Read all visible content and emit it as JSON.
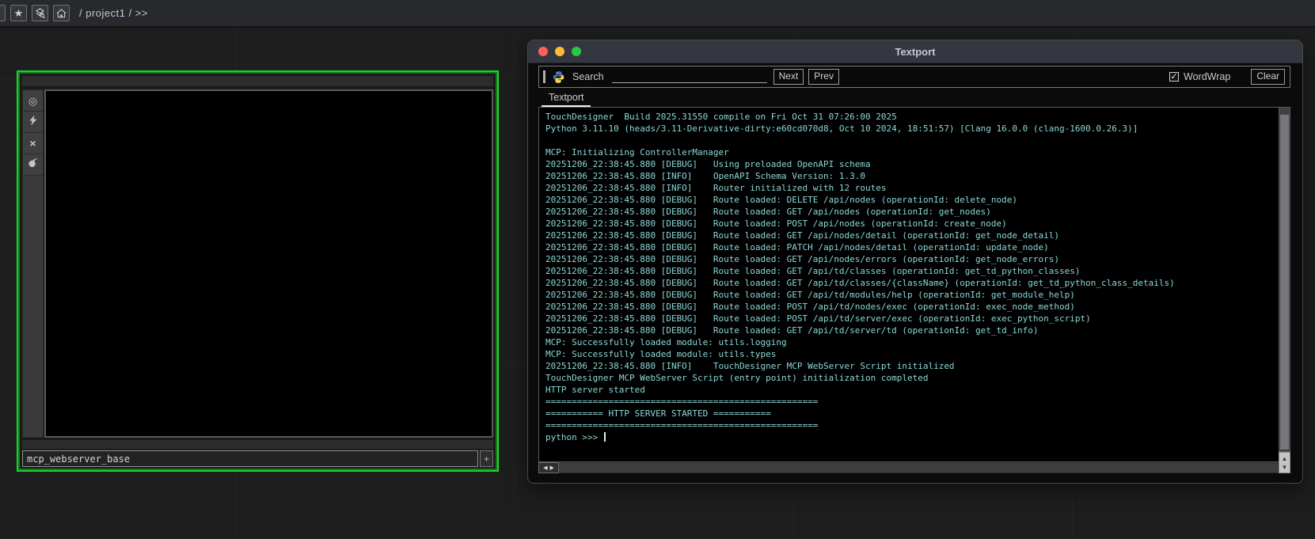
{
  "page_bg": "#1e1e1f",
  "top_toolbar": {
    "breadcrumb": "/ project1 / >>",
    "icons": [
      "star-icon",
      "palette-search-icon",
      "home-icon"
    ]
  },
  "glyphs": {
    "star": "★",
    "plus": "+",
    "check": "✓",
    "close_x": "×",
    "bullseye": "◎",
    "arrow_left": "◀",
    "arrow_right": "▶",
    "arrow_up": "▲",
    "arrow_down": "▼"
  },
  "node_panel": {
    "name_value": "mcp_webserver_base",
    "selection_color": "#21cd2e",
    "flag_icons": [
      "bullseye-icon",
      "lightning-icon",
      "close-x-icon",
      "bomb-icon"
    ]
  },
  "textport": {
    "window_title": "Textport",
    "traffic_light_colors": [
      "#ff5f57",
      "#febc2e",
      "#28c840"
    ],
    "search_label": "Search",
    "search_value": "",
    "next_label": "Next",
    "prev_label": "Prev",
    "wordwrap_label": "WordWrap",
    "wordwrap_checked": true,
    "clear_label": "Clear",
    "tab_label": "Textport",
    "console_text_color": "#8ed7d7",
    "prompt": "python >>> ",
    "console_lines": [
      "TouchDesigner  Build 2025.31550 compile on Fri Oct 31 07:26:00 2025",
      "Python 3.11.10 (heads/3.11-Derivative-dirty:e60cd070d8, Oct 10 2024, 18:51:57) [Clang 16.0.0 (clang-1600.0.26.3)]",
      "",
      "MCP: Initializing ControllerManager",
      "20251206_22:38:45.880 [DEBUG]   Using preloaded OpenAPI schema",
      "20251206_22:38:45.880 [INFO]    OpenAPI Schema Version: 1.3.0",
      "20251206_22:38:45.880 [INFO]    Router initialized with 12 routes",
      "20251206_22:38:45.880 [DEBUG]   Route loaded: DELETE /api/nodes (operationId: delete_node)",
      "20251206_22:38:45.880 [DEBUG]   Route loaded: GET /api/nodes (operationId: get_nodes)",
      "20251206_22:38:45.880 [DEBUG]   Route loaded: POST /api/nodes (operationId: create_node)",
      "20251206_22:38:45.880 [DEBUG]   Route loaded: GET /api/nodes/detail (operationId: get_node_detail)",
      "20251206_22:38:45.880 [DEBUG]   Route loaded: PATCH /api/nodes/detail (operationId: update_node)",
      "20251206_22:38:45.880 [DEBUG]   Route loaded: GET /api/nodes/errors (operationId: get_node_errors)",
      "20251206_22:38:45.880 [DEBUG]   Route loaded: GET /api/td/classes (operationId: get_td_python_classes)",
      "20251206_22:38:45.880 [DEBUG]   Route loaded: GET /api/td/classes/{className} (operationId: get_td_python_class_details)",
      "20251206_22:38:45.880 [DEBUG]   Route loaded: GET /api/td/modules/help (operationId: get_module_help)",
      "20251206_22:38:45.880 [DEBUG]   Route loaded: POST /api/td/nodes/exec (operationId: exec_node_method)",
      "20251206_22:38:45.880 [DEBUG]   Route loaded: POST /api/td/server/exec (operationId: exec_python_script)",
      "20251206_22:38:45.880 [DEBUG]   Route loaded: GET /api/td/server/td (operationId: get_td_info)",
      "MCP: Successfully loaded module: utils.logging",
      "MCP: Successfully loaded module: utils.types",
      "20251206_22:38:45.880 [INFO]    TouchDesigner MCP WebServer Script initialized",
      "TouchDesigner MCP WebServer Script (entry point) initialization completed",
      "HTTP server started",
      "====================================================",
      "=========== HTTP SERVER STARTED ===========",
      "===================================================="
    ]
  }
}
